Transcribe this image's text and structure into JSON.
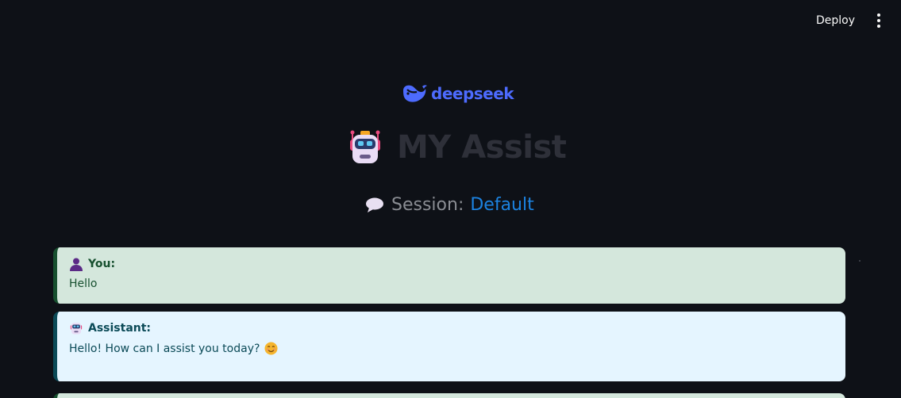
{
  "toolbar": {
    "deploy_label": "Deploy",
    "menu_icon": "vertical-ellipsis-icon"
  },
  "logo": {
    "icon": "deepseek-whale-icon",
    "text": "deepseek",
    "color": "#4d6bfe"
  },
  "header": {
    "title_icon": "robot-icon",
    "title": "MY Assist"
  },
  "session": {
    "icon": "speech-bubble-icon",
    "label": "Session:",
    "name": "Default"
  },
  "messages": [
    {
      "role_icon": "user-silhouette-icon",
      "role": "You:",
      "text": "Hello",
      "bg": "#d4e7dc",
      "accent": "#17502f"
    },
    {
      "role_icon": "robot-icon",
      "role": "Assistant:",
      "text": "Hello! How can I assist you today?",
      "trailing_icon": "smiling-face-icon",
      "bg": "#e5f5ff",
      "accent": "#0b4a57"
    }
  ],
  "colors": {
    "background": "#0e1117",
    "session_name": "#1c83e1"
  }
}
